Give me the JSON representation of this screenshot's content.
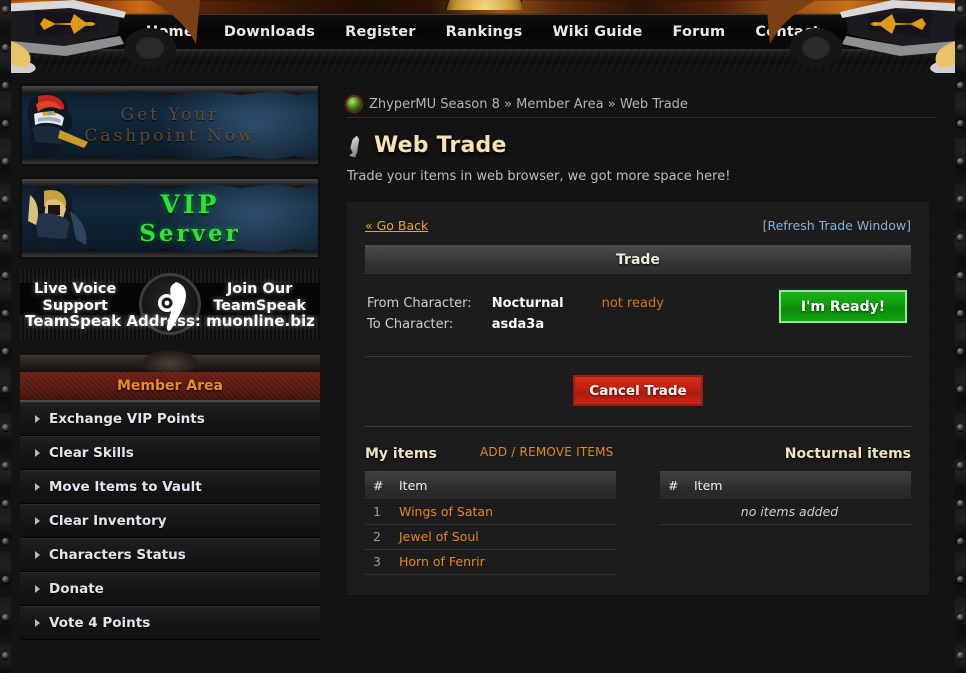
{
  "nav": {
    "items": [
      {
        "label": "Home"
      },
      {
        "label": "Downloads"
      },
      {
        "label": "Register"
      },
      {
        "label": "Rankings"
      },
      {
        "label": "Wiki Guide"
      },
      {
        "label": "Forum"
      },
      {
        "label": "Contact"
      }
    ]
  },
  "sidebar": {
    "banner1": {
      "line1": "Get Your",
      "line2": "Cashpoint Now"
    },
    "banner2": {
      "line1": "VIP",
      "line2": "Server"
    },
    "teamspeak": {
      "left": "Live Voice\nSupport",
      "left1": "Live Voice",
      "left2": "Support",
      "right1": "Join Our",
      "right2": "TeamSpeak",
      "address": "TeamSpeak Address: muonline.biz"
    },
    "menu_title": "Member Area",
    "items": [
      {
        "label": "Exchange VIP Points"
      },
      {
        "label": "Clear Skills"
      },
      {
        "label": "Move Items to Vault"
      },
      {
        "label": "Clear Inventory"
      },
      {
        "label": "Characters Status"
      },
      {
        "label": "Donate"
      },
      {
        "label": "Vote 4 Points"
      }
    ]
  },
  "content": {
    "breadcrumb": "ZhyperMU Season 8 » Member Area » Web Trade",
    "title": "Web Trade",
    "subtitle": "Trade your items in web browser, we got more space here!",
    "go_back": "« Go Back",
    "refresh": "[Refresh Trade Window]",
    "trade_bar": "Trade",
    "from_label": "From Character:",
    "from_value": "Nocturnal",
    "status": "not ready",
    "to_label": "To Character:",
    "to_value": "asda3a",
    "ready_button": "I'm Ready!",
    "cancel_button": "Cancel Trade",
    "my_items_title": "My items",
    "add_remove": "ADD / REMOVE ITEMS",
    "partner_items_title": "Nocturnal items",
    "col_num": "#",
    "col_item": "Item",
    "my_items": [
      {
        "num": "1",
        "name": "Wings of Satan"
      },
      {
        "num": "2",
        "name": "Jewel of Soul"
      },
      {
        "num": "3",
        "name": "Horn of Fenrir"
      }
    ],
    "partner_empty": "no items added"
  },
  "colors": {
    "accent_orange": "#e8861b",
    "title_cream": "#f6e3b0",
    "link_blue": "#7fb3de",
    "ready_green": "#0fa60f",
    "cancel_red": "#c01f10",
    "member_red": "#6e1f13"
  }
}
